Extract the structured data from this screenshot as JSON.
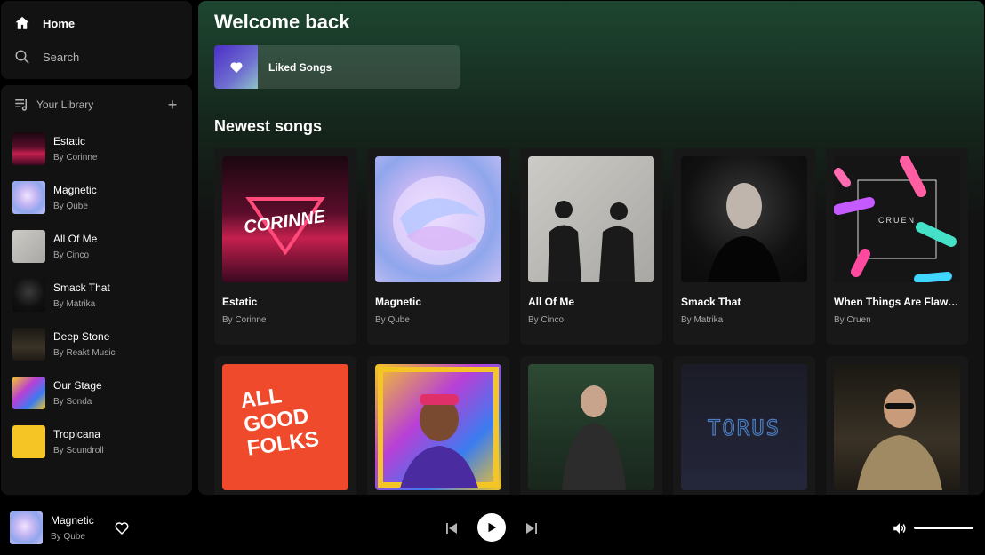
{
  "nav": {
    "home_label": "Home",
    "search_label": "Search"
  },
  "library": {
    "title": "Your Library",
    "items": [
      {
        "title": "Estatic",
        "artist": "By Corinne"
      },
      {
        "title": "Magnetic",
        "artist": "By Qube"
      },
      {
        "title": "All Of Me",
        "artist": "By Cinco"
      },
      {
        "title": "Smack That",
        "artist": "By Matrika"
      },
      {
        "title": "Deep Stone",
        "artist": "By Reakt Music"
      },
      {
        "title": "Our Stage",
        "artist": "By Sonda"
      },
      {
        "title": "Tropicana",
        "artist": "By Soundroll"
      }
    ]
  },
  "main": {
    "welcome": "Welcome back",
    "liked_songs": "Liked Songs",
    "section_title": "Newest songs",
    "cards": [
      {
        "title": "Estatic",
        "artist": "By Corinne",
        "art_text": "CORINNE"
      },
      {
        "title": "Magnetic",
        "artist": "By Qube",
        "art_text": ""
      },
      {
        "title": "All Of Me",
        "artist": "By Cinco",
        "art_text": ""
      },
      {
        "title": "Smack That",
        "artist": "By Matrika",
        "art_text": ""
      },
      {
        "title": "When Things Are Flawless",
        "artist": "By Cruen",
        "art_text": "CRUEN"
      },
      {
        "title": "",
        "artist": "",
        "art_text": "ALL GOOD FOLKS"
      },
      {
        "title": "",
        "artist": "",
        "art_text": ""
      },
      {
        "title": "",
        "artist": "",
        "art_text": ""
      },
      {
        "title": "",
        "artist": "",
        "art_text": "TORUS"
      },
      {
        "title": "",
        "artist": "",
        "art_text": ""
      }
    ]
  },
  "player": {
    "title": "Magnetic",
    "artist": "By Qube",
    "volume_level": 1.0
  },
  "colors": {
    "accent_green": "#1d4630",
    "background": "#121212"
  }
}
